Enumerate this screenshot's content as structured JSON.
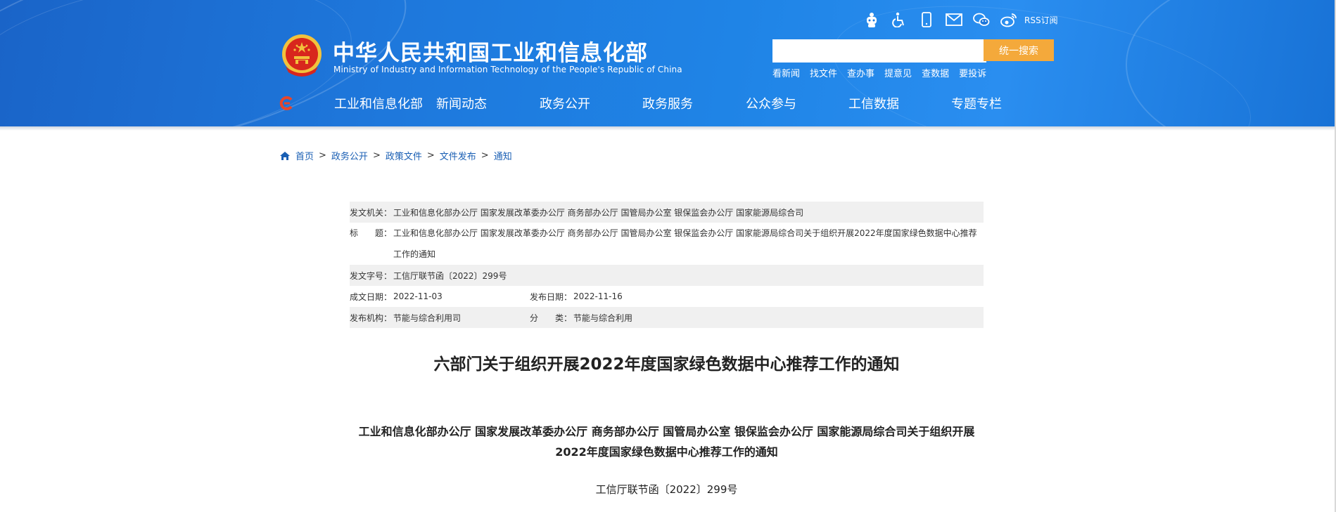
{
  "header": {
    "title": "中华人民共和国工业和信息化部",
    "subtitle": "Ministry of Industry and Information Technology of the People's Republic of China",
    "rss_label": "RSS订阅",
    "icons": [
      "robot-icon",
      "accessibility-icon",
      "mobile-icon",
      "mail-icon",
      "wechat-icon",
      "weibo-icon"
    ],
    "search": {
      "placeholder": "",
      "button_label": "统一搜索"
    },
    "quick_links": [
      "看新闻",
      "找文件",
      "查办事",
      "提意见",
      "查数据",
      "要投诉"
    ],
    "nav": [
      "工业和信息化部",
      "新闻动态",
      "政务公开",
      "政务服务",
      "公众参与",
      "工信数据",
      "专题专栏"
    ],
    "colors": {
      "brand_blue": "#1e78dc",
      "search_button": "#f4a93b",
      "emblem_red": "#d8261d",
      "emblem_gold": "#f2c23c"
    }
  },
  "breadcrumb": [
    "首页",
    "政务公开",
    "政策文件",
    "文件发布",
    "通知"
  ],
  "meta": {
    "issuer_label": "发文机关：",
    "issuer": "工业和信息化部办公厅 国家发展改革委办公厅 商务部办公厅 国管局办公室 银保监会办公厅 国家能源局综合司",
    "title_label": "标　　题：",
    "title": "工业和信息化部办公厅 国家发展改革委办公厅 商务部办公厅 国管局办公室 银保监会办公厅 国家能源局综合司关于组织开展2022年度国家绿色数据中心推荐工作的通知",
    "doc_no_label": "发文字号：",
    "doc_no": "工信厅联节函〔2022〕299号",
    "written_date_label": "成文日期：",
    "written_date": "2022-11-03",
    "publish_date_label": "发布日期：",
    "publish_date": "2022-11-16",
    "agency_label": "发布机构：",
    "agency": "节能与综合利用司",
    "category_label": "分　　类：",
    "category": "节能与综合利用"
  },
  "document": {
    "title": "六部门关于组织开展2022年度国家绿色数据中心推荐工作的通知",
    "heading": "工业和信息化部办公厅 国家发展改革委办公厅 商务部办公厅 国管局办公室 银保监会办公厅 国家能源局综合司关于组织开展2022年度国家绿色数据中心推荐工作的通知",
    "number": "工信厅联节函〔2022〕299号"
  }
}
